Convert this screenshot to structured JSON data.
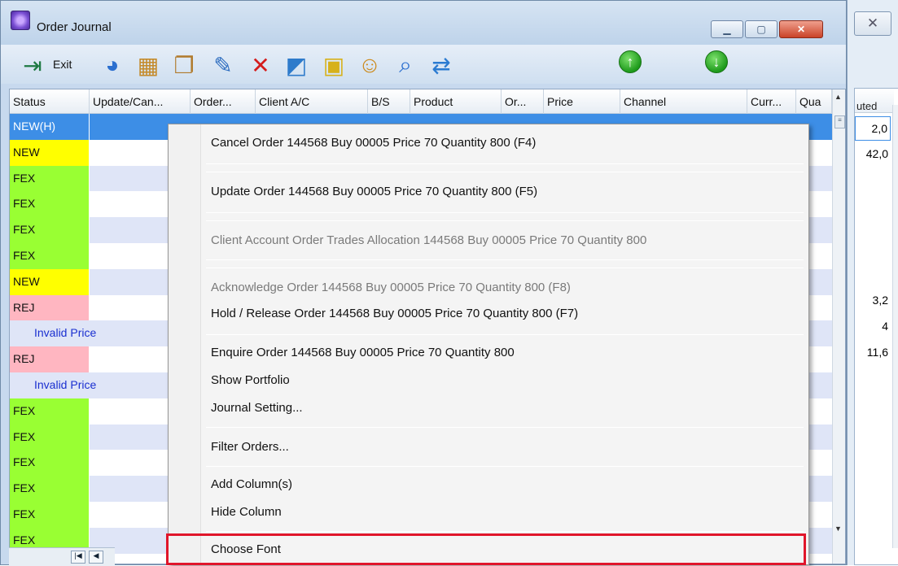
{
  "window": {
    "title": "Order Journal"
  },
  "toolbar": {
    "exit_label": "Exit"
  },
  "columns": [
    "Status",
    "Update/Can...",
    "Order...",
    "Client A/C",
    "B/S",
    "Product",
    "Or...",
    "Price",
    "Channel",
    "Curr...",
    "Qua"
  ],
  "selected_row": {
    "status": "NEW(H)"
  },
  "rows": [
    {
      "status": "NEW",
      "color": "#ffff00"
    },
    {
      "status": "FEX",
      "color": "#99ff33"
    },
    {
      "status": "FEX",
      "color": "#99ff33"
    },
    {
      "status": "FEX",
      "color": "#99ff33"
    },
    {
      "status": "FEX",
      "color": "#99ff33"
    },
    {
      "status": "NEW",
      "color": "#ffff00"
    },
    {
      "status": "REJ",
      "color": "#ffb6c1"
    },
    {
      "status": "",
      "color": "",
      "note": "Invalid Price"
    },
    {
      "status": "REJ",
      "color": "#ffb6c1"
    },
    {
      "status": "",
      "color": "",
      "note": "Invalid Price"
    },
    {
      "status": "FEX",
      "color": "#99ff33"
    },
    {
      "status": "FEX",
      "color": "#99ff33"
    },
    {
      "status": "FEX",
      "color": "#99ff33"
    },
    {
      "status": "FEX",
      "color": "#99ff33"
    },
    {
      "status": "FEX",
      "color": "#99ff33"
    },
    {
      "status": "FEX",
      "color": "#99ff33"
    }
  ],
  "context_menu": {
    "cancel": "Cancel Order 144568 Buy 00005 Price 70 Quantity 800 (F4)",
    "update": "Update Order 144568 Buy 00005 Price 70 Quantity 800 (F5)",
    "allocation": "Client Account Order Trades Allocation 144568 Buy 00005 Price 70 Quantity 800",
    "acknowledge": "Acknowledge Order 144568 Buy 00005 Price 70 Quantity 800 (F8)",
    "hold": "Hold / Release Order 144568 Buy 00005 Price 70 Quantity 800 (F7)",
    "enquire": "Enquire Order 144568 Buy 00005 Price 70 Quantity 800",
    "portfolio": "Show Portfolio",
    "journal": "Journal Setting...",
    "filter": "Filter Orders...",
    "add_col": "Add Column(s)",
    "hide_col": "Hide Column",
    "font": "Choose Font"
  },
  "side_window": {
    "header": "uted",
    "values": [
      "2,0",
      "42,0",
      "",
      "",
      "",
      "",
      "3,2",
      "4",
      "11,6"
    ]
  },
  "icons": [
    "exit-icon",
    "globe-icon",
    "packages-icon",
    "book-icon",
    "edit-icon",
    "delete-icon",
    "chart-icon",
    "lock-icon",
    "user-icon",
    "search-icon",
    "export-icon",
    "arrow-up-icon",
    "arrow-down-icon"
  ]
}
